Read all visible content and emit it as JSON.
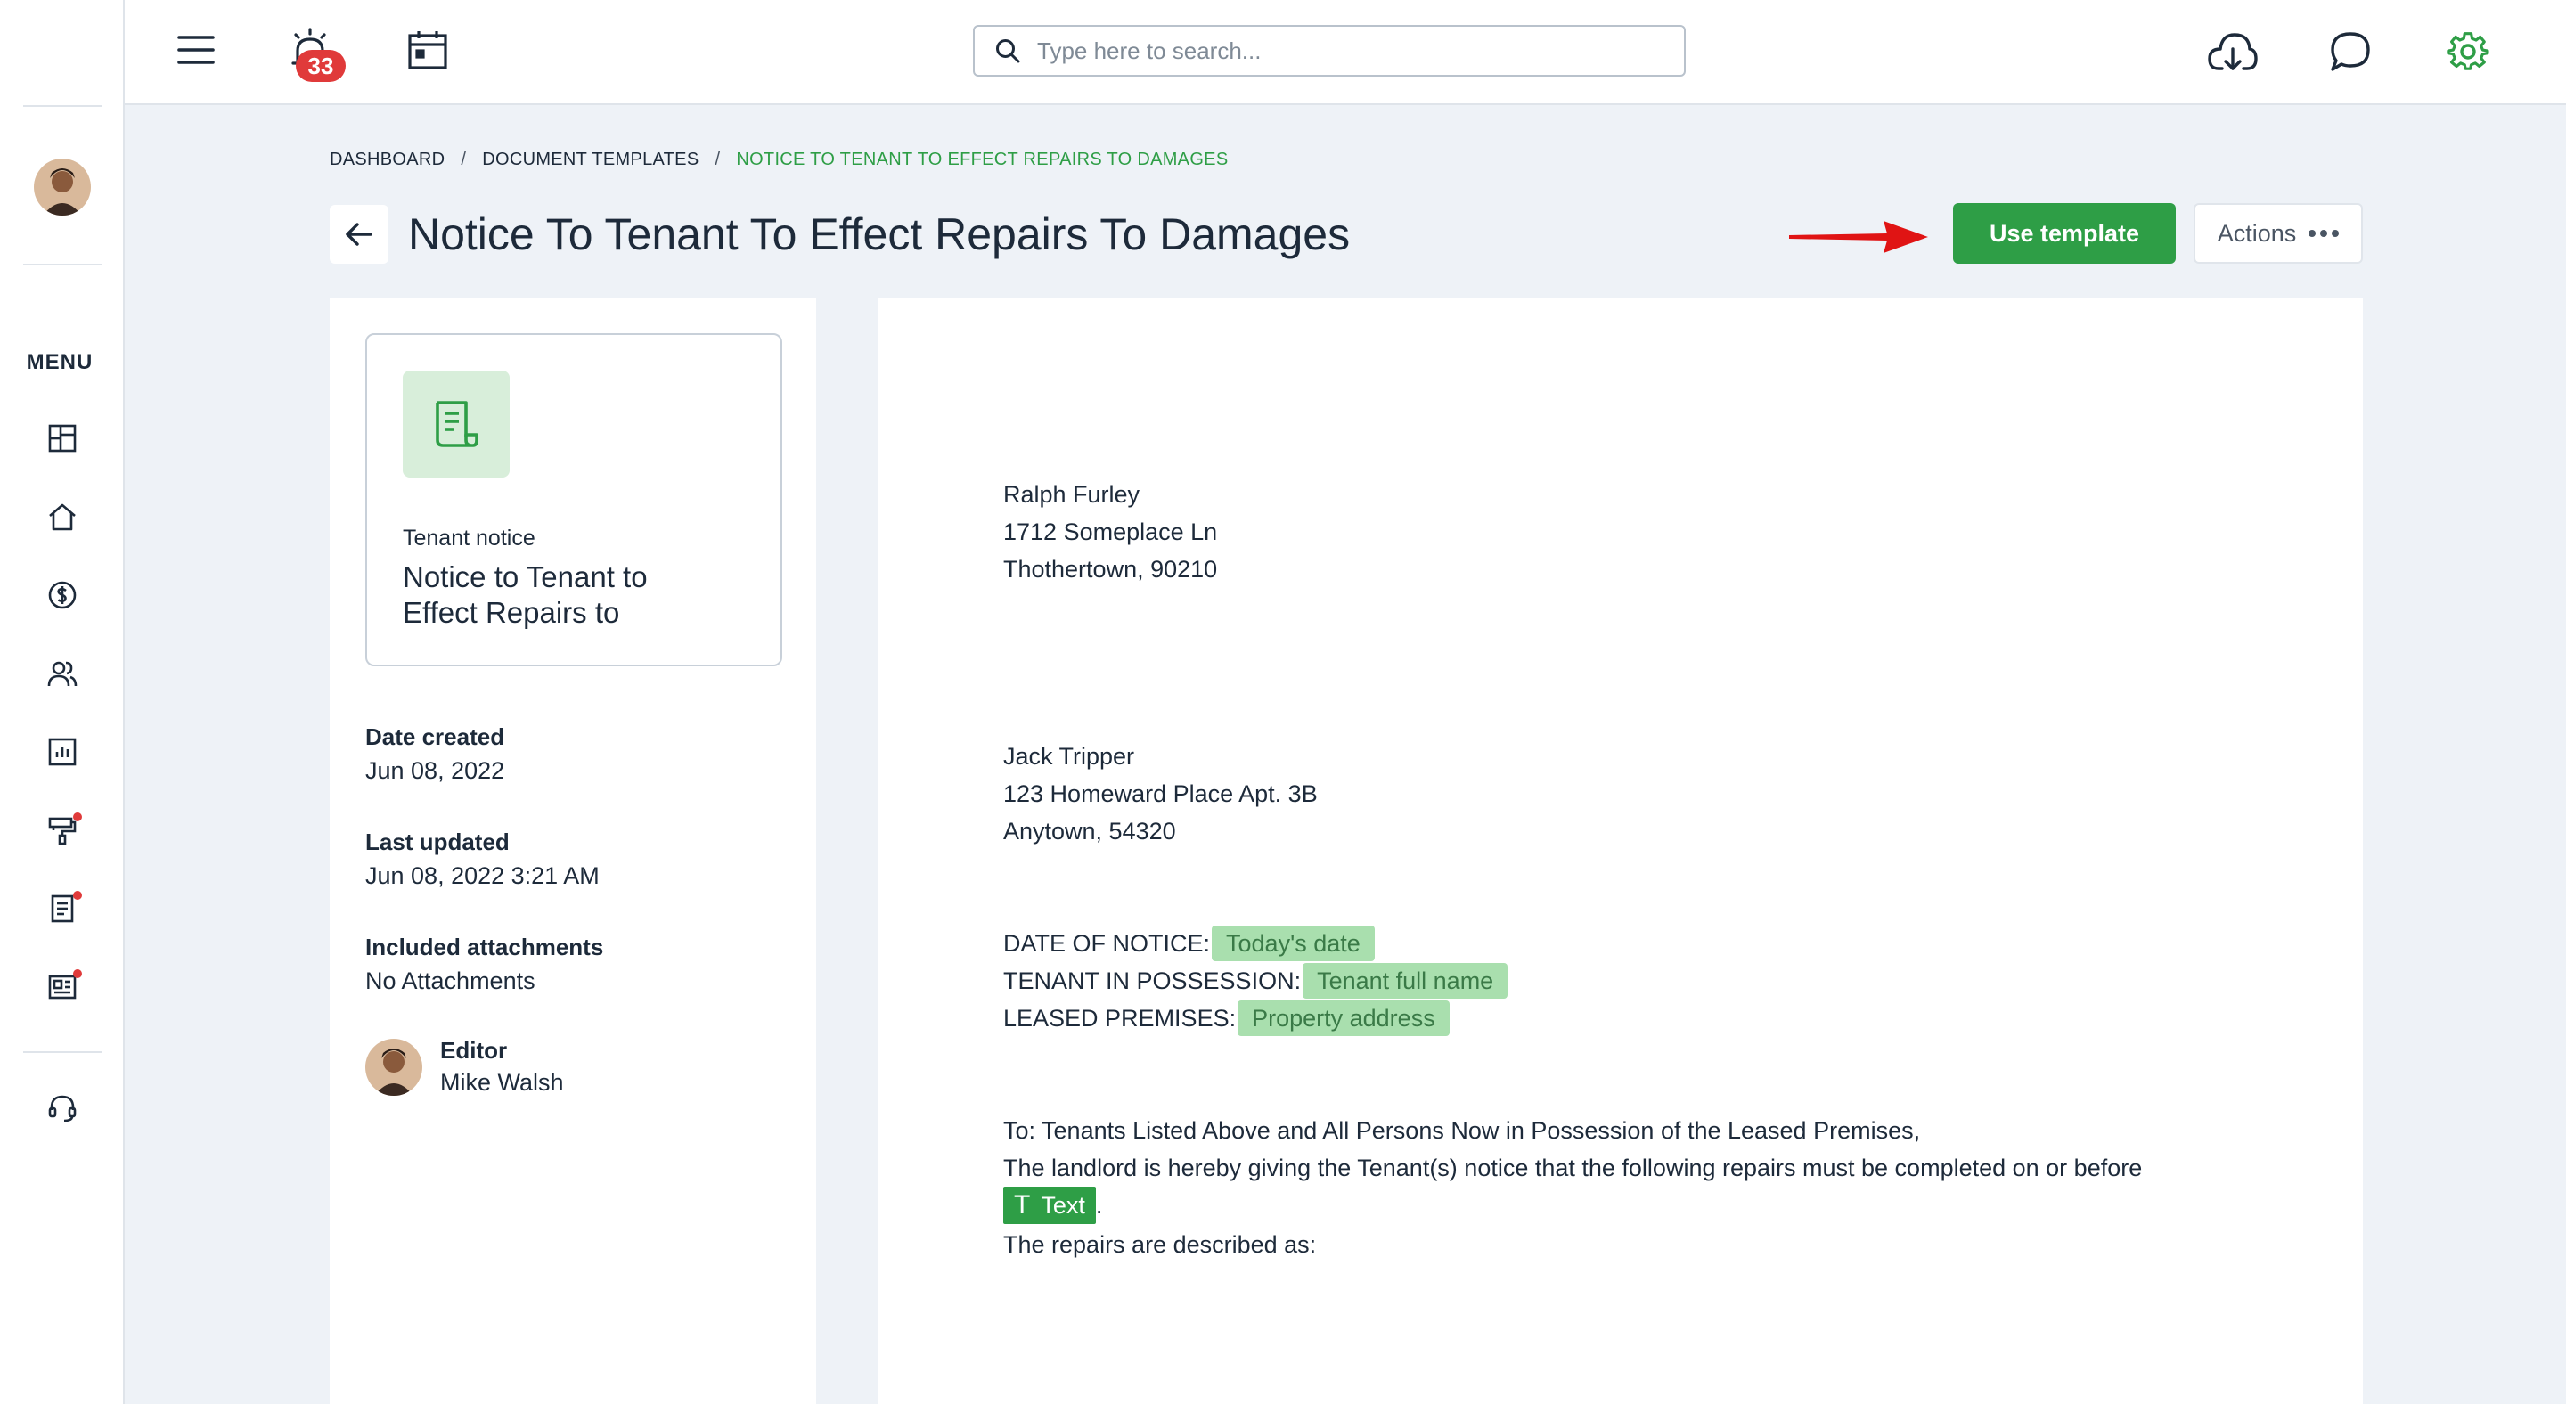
{
  "topbar": {
    "alarm_count": "33",
    "search_placeholder": "Type here to search..."
  },
  "sidebar": {
    "menu_label": "MENU"
  },
  "breadcrumb": {
    "items": [
      "DASHBOARD",
      "DOCUMENT TEMPLATES",
      "NOTICE TO TENANT TO EFFECT REPAIRS TO DAMAGES"
    ],
    "separator": "/"
  },
  "header": {
    "title": "Notice To Tenant To Effect Repairs To Damages",
    "use_template_label": "Use template",
    "actions_label": "Actions"
  },
  "template_card": {
    "type": "Tenant notice",
    "name": "Notice to Tenant to Effect Repairs to"
  },
  "meta": {
    "date_created_label": "Date created",
    "date_created": "Jun 08, 2022",
    "last_updated_label": "Last updated",
    "last_updated": "Jun 08, 2022 3:21 AM",
    "attachments_label": "Included attachments",
    "attachments": "No Attachments",
    "editor_label": "Editor",
    "editor_name": "Mike Walsh"
  },
  "document": {
    "sender": [
      "Ralph Furley",
      "1712 Someplace Ln",
      "Thothertown, 90210"
    ],
    "recipient": [
      "Jack Tripper",
      "123 Homeward Place Apt. 3B",
      "Anytown, 54320"
    ],
    "date_label": "DATE OF NOTICE:",
    "date_tag": "Today's date",
    "tenant_label": "TENANT IN POSSESSION:",
    "tenant_tag": "Tenant full name",
    "premises_label": "LEASED PREMISES:",
    "premises_tag": "Property address",
    "body_line1": "To: Tenants Listed Above and All Persons Now in Possession of the Leased Premises,",
    "body_line2": "The landlord is hereby giving the Tenant(s) notice that the following repairs must be completed on or before",
    "text_field_icon": "T",
    "text_field_label": "Text",
    "text_field_suffix": ".",
    "body_line3": "The repairs are described as:"
  },
  "colors": {
    "accent_green": "#2e9e46",
    "tag_green": "#a9dfae",
    "badge_red": "#e03a3a",
    "annotation_arrow": "#e01414"
  }
}
